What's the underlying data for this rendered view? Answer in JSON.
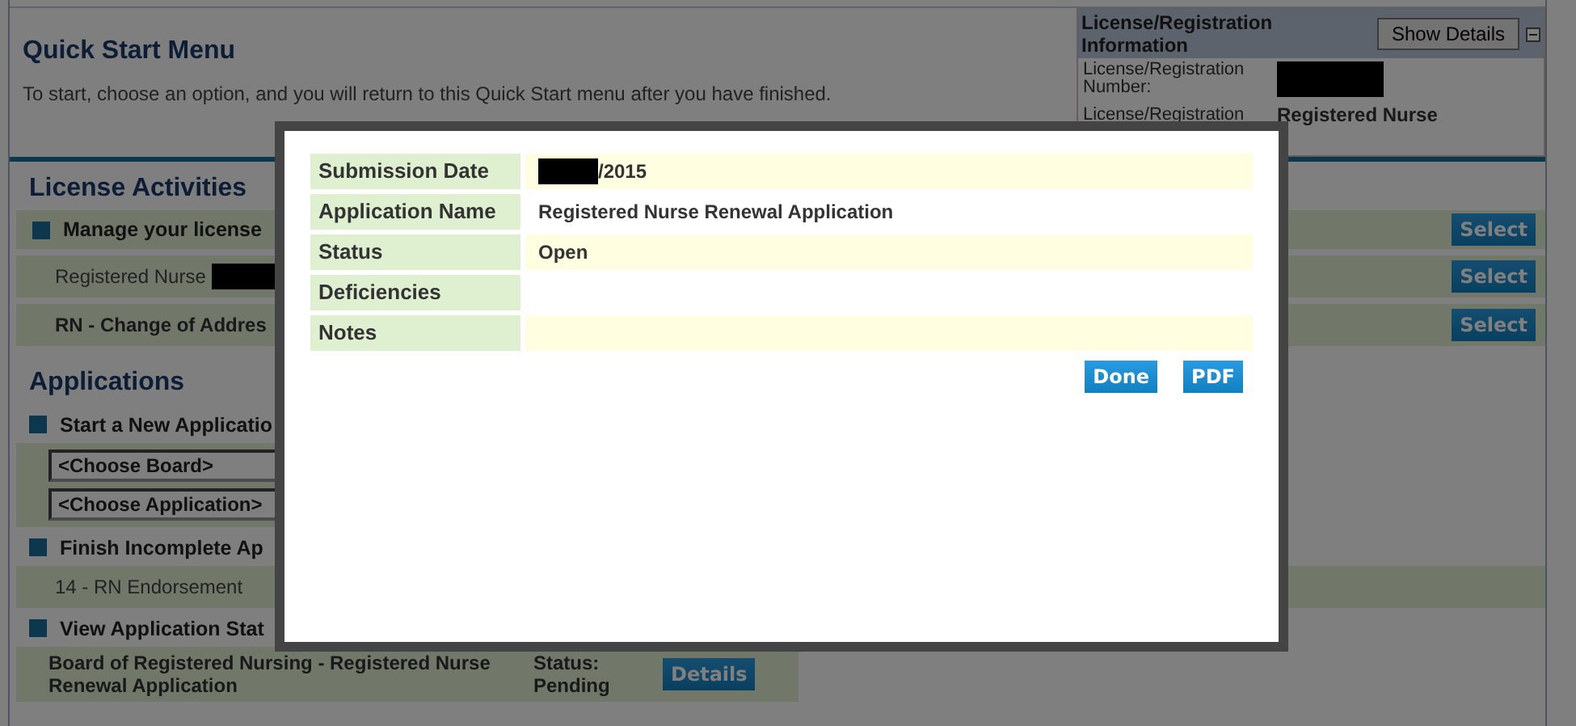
{
  "quick_start": {
    "title": "Quick Start Menu",
    "description": "To start, choose an option, and you will return to this Quick Start menu after you have finished."
  },
  "license_panel": {
    "title": "License/Registration Information",
    "button": "Show Details",
    "expanded": true,
    "fields": [
      {
        "label": "License/Registration Number:",
        "redacted": true
      },
      {
        "label": "License/Registration",
        "value": "Registered Nurse",
        "redacted": false
      }
    ]
  },
  "license_activities": {
    "title": "License Activities",
    "rows": [
      {
        "text": "Manage your license",
        "kind": "heading",
        "redacted": false,
        "button": "Select"
      },
      {
        "text": "Registered Nurse",
        "kind": "item",
        "redacted": true,
        "button": "Select"
      },
      {
        "text": "RN - Change of Addres",
        "kind": "item-bold",
        "redacted": false,
        "button": "Select"
      }
    ]
  },
  "applications": {
    "title": "Applications",
    "groups": [
      {
        "heading": "Start a New Applicatio",
        "kind": "selects",
        "fields": [
          "<Choose Board>",
          "<Choose Application>"
        ]
      },
      {
        "heading": "Finish Incomplete Ap",
        "kind": "list",
        "rows": [
          "14 - RN Endorsement"
        ]
      },
      {
        "heading": "View Application Stat",
        "kind": "status",
        "rows": [
          {
            "name": "Board of Registered Nursing - Registered Nurse Renewal Application",
            "status": "Status: Pending",
            "button": "Details"
          }
        ]
      }
    ]
  },
  "dialog": {
    "rows": [
      {
        "label": "Submission Date",
        "value": "/2015",
        "redacted": true
      },
      {
        "label": "Application Name",
        "value": "Registered Nurse Renewal Application",
        "redacted": false
      },
      {
        "label": "Status",
        "value": "Open",
        "redacted": false
      },
      {
        "label": "Deficiencies",
        "redacted": false
      },
      {
        "label": "Notes",
        "redacted": false
      }
    ],
    "buttons": [
      "Done",
      "PDF"
    ]
  }
}
